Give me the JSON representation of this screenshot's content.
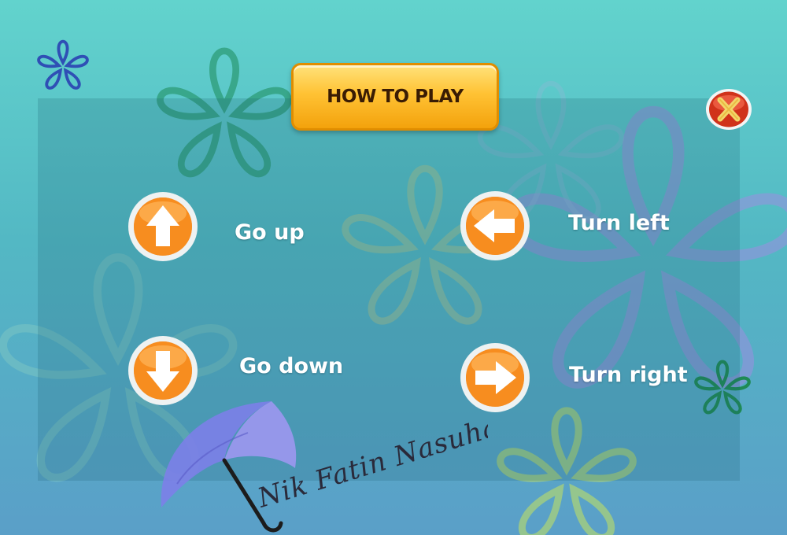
{
  "header": {
    "title": "HOW TO PLAY"
  },
  "controls": [
    {
      "key": "up",
      "label": "Go up",
      "icon": "arrow-up-icon"
    },
    {
      "key": "down",
      "label": "Go down",
      "icon": "arrow-down-icon"
    },
    {
      "key": "left",
      "label": "Turn left",
      "icon": "arrow-left-icon"
    },
    {
      "key": "right",
      "label": "Turn right",
      "icon": "arrow-right-icon"
    }
  ],
  "close": {
    "icon": "close-icon"
  },
  "signature": {
    "text": "Nik Fatin Nasuha"
  },
  "colors": {
    "background_top": "#62d3cd",
    "background_bottom": "#5a9fc8",
    "title_button": "#ffc234",
    "title_text": "#3a1c04",
    "arrow_button": "#f07a10",
    "close_button": "#d0321a",
    "close_x": "#f2d66a",
    "label_text": "#ffffff"
  }
}
